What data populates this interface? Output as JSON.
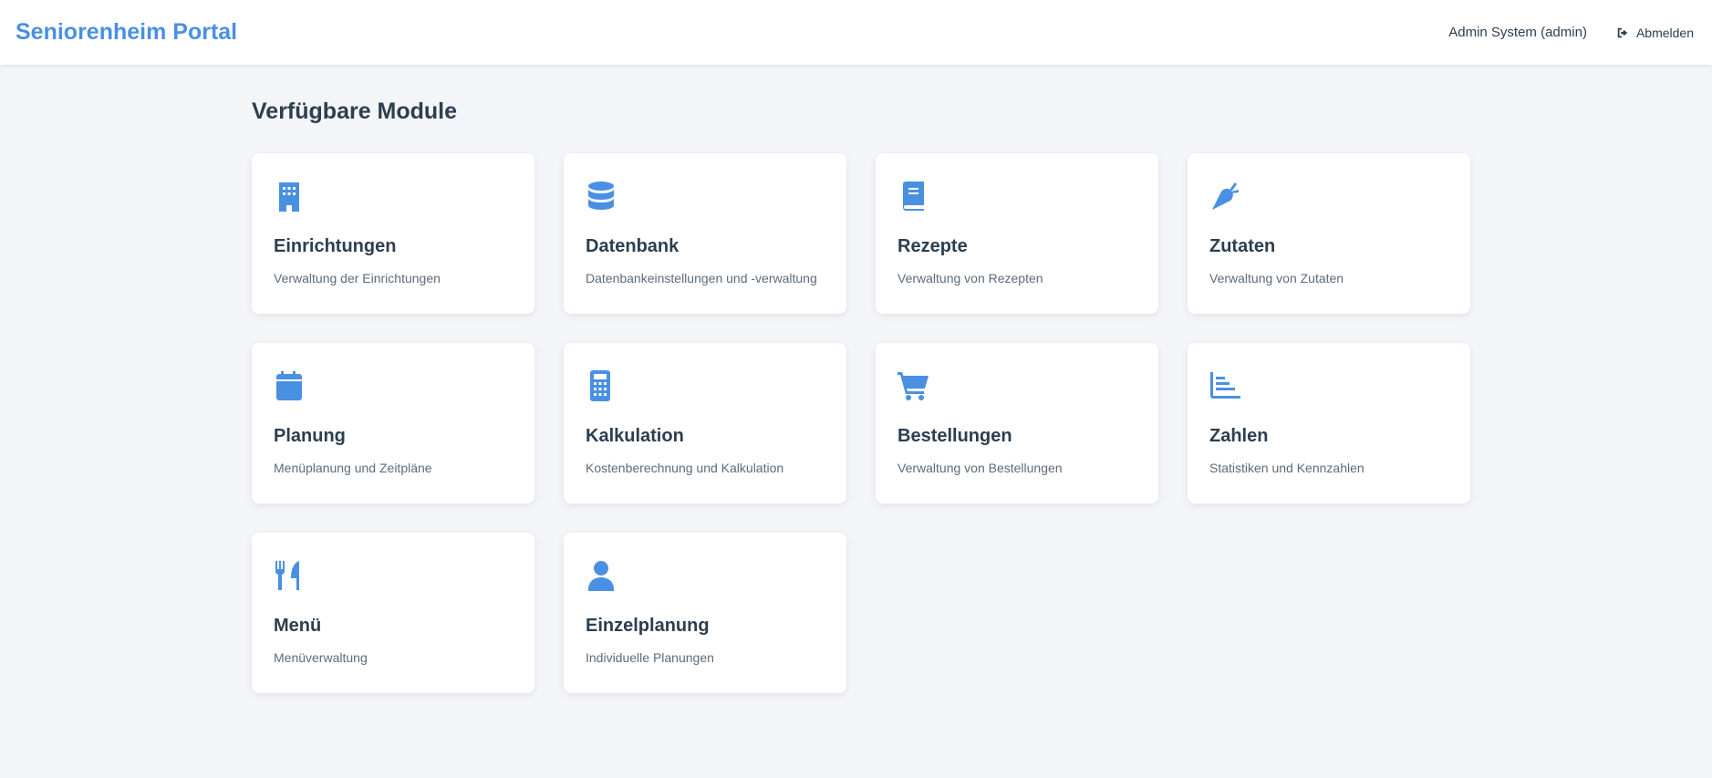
{
  "header": {
    "brand": "Seniorenheim Portal",
    "user": "Admin System (admin)",
    "logout_label": "Abmelden"
  },
  "main": {
    "title": "Verfügbare Module",
    "modules": [
      {
        "icon": "building-icon",
        "title": "Einrichtungen",
        "description": "Verwaltung der Einrichtungen"
      },
      {
        "icon": "database-icon",
        "title": "Datenbank",
        "description": "Datenbankeinstellungen und -verwaltung"
      },
      {
        "icon": "book-icon",
        "title": "Rezepte",
        "description": "Verwaltung von Rezepten"
      },
      {
        "icon": "carrot-icon",
        "title": "Zutaten",
        "description": "Verwaltung von Zutaten"
      },
      {
        "icon": "calendar-icon",
        "title": "Planung",
        "description": "Menüplanung und Zeitpläne"
      },
      {
        "icon": "calculator-icon",
        "title": "Kalkulation",
        "description": "Kostenberechnung und Kalkulation"
      },
      {
        "icon": "cart-icon",
        "title": "Bestellungen",
        "description": "Verwaltung von Bestellungen"
      },
      {
        "icon": "chart-icon",
        "title": "Zahlen",
        "description": "Statistiken und Kennzahlen"
      },
      {
        "icon": "utensils-icon",
        "title": "Menü",
        "description": "Menüverwaltung"
      },
      {
        "icon": "user-icon",
        "title": "Einzelplanung",
        "description": "Individuelle Planungen"
      }
    ]
  },
  "colors": {
    "accent": "#4a90e2",
    "text": "#2c3e50",
    "background": "#f4f5f8"
  }
}
